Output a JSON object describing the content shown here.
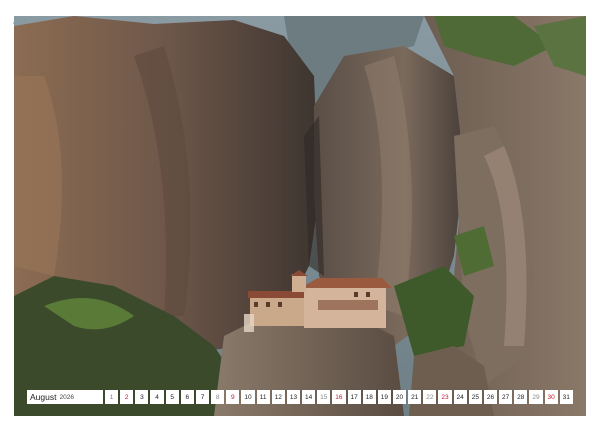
{
  "calendar": {
    "month": "August",
    "year": "2026",
    "days": [
      {
        "n": "1",
        "type": "sat"
      },
      {
        "n": "2",
        "type": "sun"
      },
      {
        "n": "3",
        "type": "day"
      },
      {
        "n": "4",
        "type": "day"
      },
      {
        "n": "5",
        "type": "day"
      },
      {
        "n": "6",
        "type": "day"
      },
      {
        "n": "7",
        "type": "day"
      },
      {
        "n": "8",
        "type": "sat"
      },
      {
        "n": "9",
        "type": "sun"
      },
      {
        "n": "10",
        "type": "day"
      },
      {
        "n": "11",
        "type": "day"
      },
      {
        "n": "12",
        "type": "day"
      },
      {
        "n": "13",
        "type": "day"
      },
      {
        "n": "14",
        "type": "day"
      },
      {
        "n": "15",
        "type": "sat"
      },
      {
        "n": "16",
        "type": "sun"
      },
      {
        "n": "17",
        "type": "day"
      },
      {
        "n": "18",
        "type": "day"
      },
      {
        "n": "19",
        "type": "day"
      },
      {
        "n": "20",
        "type": "day"
      },
      {
        "n": "21",
        "type": "day"
      },
      {
        "n": "22",
        "type": "sat"
      },
      {
        "n": "23",
        "type": "sun"
      },
      {
        "n": "24",
        "type": "day"
      },
      {
        "n": "25",
        "type": "day"
      },
      {
        "n": "26",
        "type": "day"
      },
      {
        "n": "27",
        "type": "day"
      },
      {
        "n": "28",
        "type": "day"
      },
      {
        "n": "29",
        "type": "sat"
      },
      {
        "n": "30",
        "type": "sun"
      },
      {
        "n": "31",
        "type": "day"
      }
    ]
  },
  "colors": {
    "sunday": "#c0182b",
    "saturday": "#888888",
    "weekday": "#222222"
  },
  "photo": {
    "subject": "monastery on rock pillar"
  }
}
